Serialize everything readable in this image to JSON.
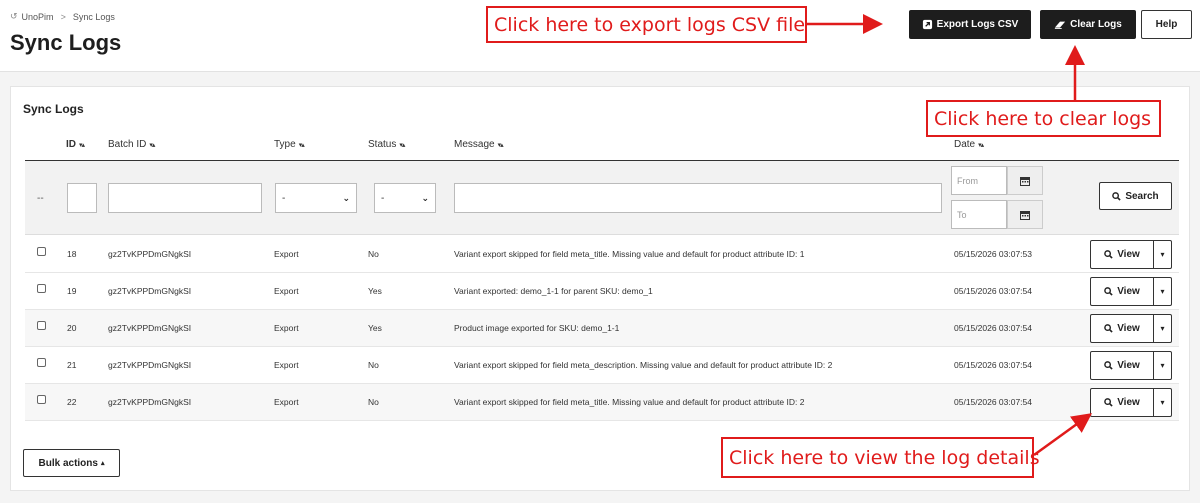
{
  "breadcrumb": {
    "root": "UnoPim",
    "current": "Sync Logs"
  },
  "page_title": "Sync Logs",
  "toolbar": {
    "export_label": "Export Logs CSV",
    "clear_label": "Clear Logs",
    "help_label": "Help"
  },
  "panel": {
    "title": "Sync Logs"
  },
  "columns": {
    "id": "ID",
    "batch_id": "Batch ID",
    "type": "Type",
    "status": "Status",
    "message": "Message",
    "date": "Date"
  },
  "filters": {
    "dash": "--",
    "type_value": "-",
    "status_value": "-",
    "date_from_placeholder": "From",
    "date_to_placeholder": "To",
    "search_label": "Search"
  },
  "rows": [
    {
      "id": "18",
      "batch": "gz2TvKPPDmGNgkSI",
      "type": "Export",
      "status": "No",
      "message": "Variant export skipped for field meta_title. Missing value and default for product attribute ID: 1",
      "date": "05/15/2026 03:07:53"
    },
    {
      "id": "19",
      "batch": "gz2TvKPPDmGNgkSI",
      "type": "Export",
      "status": "Yes",
      "message": "Variant exported: demo_1-1 for parent SKU: demo_1",
      "date": "05/15/2026 03:07:54"
    },
    {
      "id": "20",
      "batch": "gz2TvKPPDmGNgkSI",
      "type": "Export",
      "status": "Yes",
      "message": "Product image exported for SKU: demo_1-1",
      "date": "05/15/2026 03:07:54"
    },
    {
      "id": "21",
      "batch": "gz2TvKPPDmGNgkSI",
      "type": "Export",
      "status": "No",
      "message": "Variant export skipped for field meta_description. Missing value and default for product attribute ID: 2",
      "date": "05/15/2026 03:07:54"
    },
    {
      "id": "22",
      "batch": "gz2TvKPPDmGNgkSI",
      "type": "Export",
      "status": "No",
      "message": "Variant export skipped for field meta_title. Missing value and default for product attribute ID: 2",
      "date": "05/15/2026 03:07:54"
    }
  ],
  "row_action": {
    "view_label": "View"
  },
  "bulk_actions_label": "Bulk actions",
  "annotations": {
    "export": "Click here to export logs CSV file",
    "clear": "Click here to clear logs",
    "view": "Click here to view the log details"
  },
  "colors": {
    "annotation": "#e01b1b",
    "dark_button": "#1d1d1d"
  },
  "icons": [
    "sync-icon",
    "export-icon",
    "eraser-icon",
    "calendar-icon",
    "search-icon",
    "caret-down-icon",
    "sort-icon"
  ]
}
